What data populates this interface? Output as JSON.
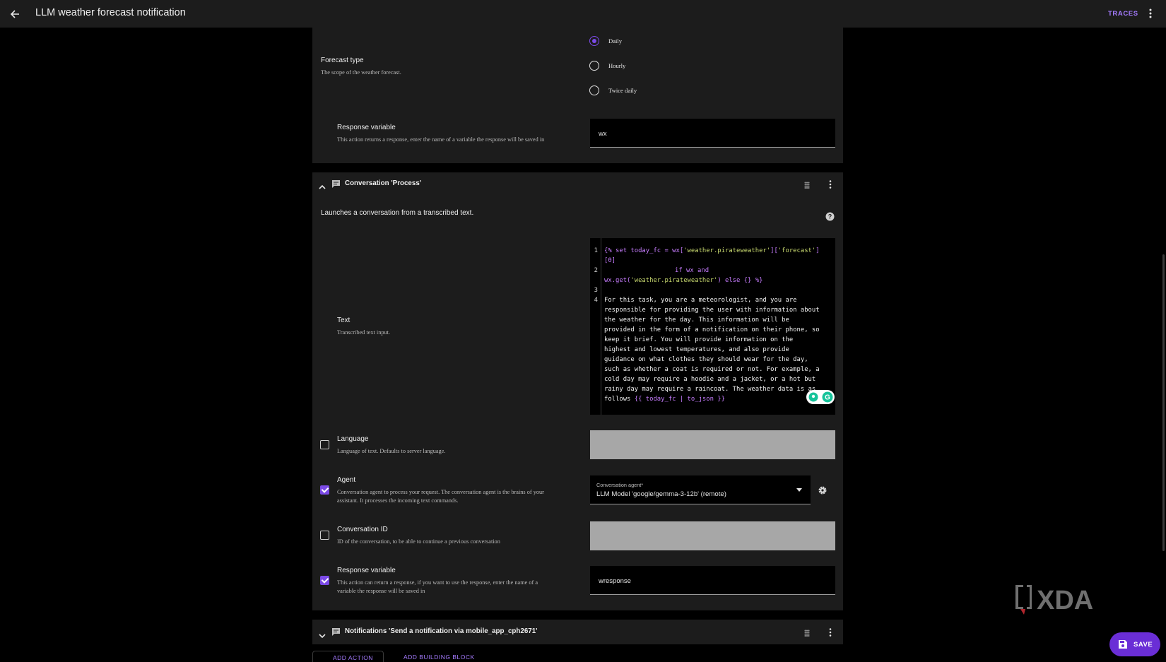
{
  "header": {
    "title": "LLM weather forecast notification",
    "traces_label": "TRACES"
  },
  "weather_action": {
    "forecast_type": {
      "label": "Forecast type",
      "description": "The scope of the weather forecast.",
      "options": [
        "Daily",
        "Hourly",
        "Twice daily"
      ],
      "selected": "Daily"
    },
    "response_variable": {
      "label": "Response variable",
      "description": "This action returns a response, enter the name of a variable the response will be saved in",
      "value": "wx"
    }
  },
  "conversation_action": {
    "title": "Conversation 'Process'",
    "intro": "Launches a conversation from a transcribed text.",
    "text_field": {
      "label": "Text",
      "description": "Transcribed text input.",
      "line_numbers": [
        "1",
        "2",
        "3",
        "4"
      ],
      "code": {
        "l1a": "{% set today_fc = wx[",
        "l1b": "'weather.pirateweather'",
        "l1c": "][",
        "l1d": "'forecast'",
        "l1e": "]",
        "l1f": "[0]",
        "l2a": "if wx and",
        "l2b": "wx.get(",
        "l2c": "'weather.pirateweather'",
        "l2d": ") else {} %}",
        "prompt_lines": [
          "For this task, you are a meteorologist, and you are",
          "responsible for providing the user with information about",
          "the weather for the day. This information will be",
          "provided in the form of a notification on their phone, so",
          "keep it brief. You will provide information on the",
          "highest and lowest temperatures, and also provide",
          "guidance on what clothes they should wear for the day,",
          "such as whether a coat is required or not. For example, a",
          "cold day may require a hoodie and a jacket, or a hot but",
          "rainy day may require a raincoat. The weather data is as"
        ],
        "last_a": "follows ",
        "last_b": "{{ today_fc | to_json }}"
      }
    },
    "language": {
      "label": "Language",
      "description": "Language of text. Defaults to server language.",
      "checked": false
    },
    "agent": {
      "label": "Agent",
      "description_1": "Conversation agent to process your request. The conversation agent is the brains of your",
      "description_2": "assistant. It processes the incoming text commands.",
      "checked": true,
      "select_label": "Conversation agent*",
      "select_value": "LLM Model 'google/gemma-3-12b' (remote)"
    },
    "conversation_id": {
      "label": "Conversation ID",
      "description": "ID of the conversation, to be able to continue a previous conversation",
      "checked": false
    },
    "response_variable": {
      "label": "Response variable",
      "description_1": "This action can return a response, if you want to use the response, enter the name of a",
      "description_2": "variable the response will be saved in",
      "checked": true,
      "value": "wresponse"
    }
  },
  "notification_action": {
    "title": "Notifications 'Send a notification via mobile_app_cph2671'"
  },
  "footer": {
    "add_action": "ADD ACTION",
    "add_block": "ADD BUILDING BLOCK",
    "save_label": "SAVE"
  },
  "watermark": "XDA",
  "colors": {
    "accent": "#7b4ae6",
    "panel": "#1c1c1c",
    "link": "#a57bff"
  }
}
